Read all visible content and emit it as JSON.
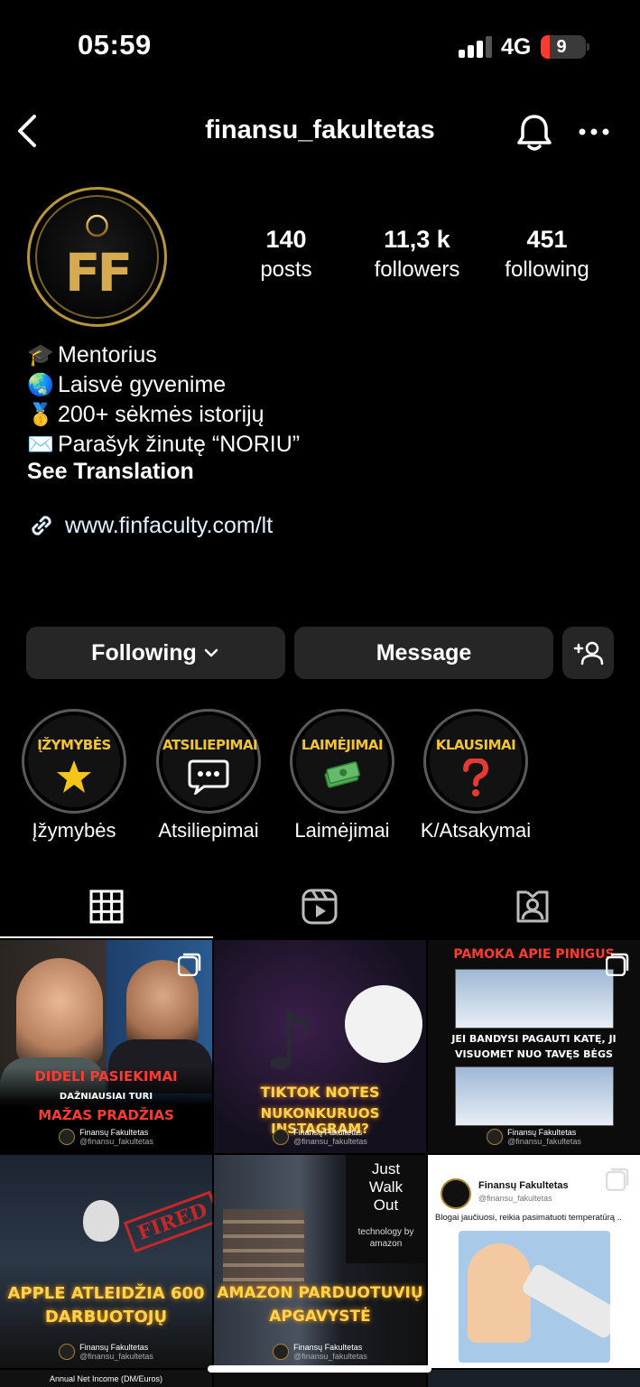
{
  "status_bar": {
    "time": "05:59",
    "network": "4G",
    "battery": "9"
  },
  "nav": {
    "username": "finansu_fakultetas",
    "back_icon": "chevron-left-icon",
    "bell_icon": "bell-icon",
    "more_icon": "more-horizontal-icon"
  },
  "profile": {
    "avatar_text": "FF",
    "stats": [
      {
        "value": "140",
        "label": "posts"
      },
      {
        "value": "11,3 k",
        "label": "followers"
      },
      {
        "value": "451",
        "label": "following"
      }
    ],
    "bio": [
      {
        "emoji": "🎓",
        "text": "Mentorius"
      },
      {
        "emoji": "🌏",
        "text": "Laisvė gyvenime"
      },
      {
        "emoji": "🥇",
        "text": "200+ sėkmės istorijų"
      },
      {
        "emoji": "✉️",
        "text": "Parašyk žinutę “NORIU”"
      }
    ],
    "see_translation": "See Translation",
    "link": "www.finfaculty.com/lt"
  },
  "buttons": {
    "following": "Following",
    "message": "Message"
  },
  "highlights": [
    {
      "title": "ĮŽYMYBĖS",
      "label": "Įžymybės",
      "icon": "star-icon"
    },
    {
      "title": "ATSILIEPIMAI",
      "label": "Atsiliepimai",
      "icon": "chat-bubble-icon"
    },
    {
      "title": "LAIMĖJIMAI",
      "label": "Laimėjimai",
      "icon": "money-icon"
    },
    {
      "title": "KLAUSIMAI",
      "label": "K/Atsakymai",
      "icon": "question-icon"
    }
  ],
  "tabs": [
    {
      "name": "grid",
      "icon": "grid-icon"
    },
    {
      "name": "reels",
      "icon": "reels-icon"
    },
    {
      "name": "tagged",
      "icon": "tagged-user-icon"
    }
  ],
  "posts": [
    {
      "lines": [
        "DIDELI PASIEKIMAI",
        "DAŽNIAUSIAI TURI",
        "MAŽAS PRADŽIAS"
      ],
      "brand": "Finansų Fakultetas",
      "handle": "@finansu_fakultetas"
    },
    {
      "lines": [
        "TIKTOK NOTES",
        "NUKONKURUOS INSTAGRAM?"
      ],
      "brand": "Finansų Fakultetas",
      "handle": "@finansu_fakultetas"
    },
    {
      "lines": [
        "PAMOKA APIE PINIGUS",
        "JEI BANDYSI PAGAUTI KATĘ, JI",
        "VISUOMET NUO TAVĘS BĖGS"
      ],
      "brand": "Finansų Fakultetas",
      "handle": "@finansu_fakultetas"
    },
    {
      "lines": [
        "APPLE ATLEIDŽIA 600",
        "DARBUOTOJŲ"
      ],
      "stamp": "FIRED",
      "brand": "Finansų Fakultetas",
      "handle": "@finansu_fakultetas"
    },
    {
      "lines": [
        "AMAZON PARDUOTUVIŲ",
        "APGAVYSTĖ"
      ],
      "sign": [
        "Just",
        "Walk",
        "Out"
      ],
      "sign_sub": [
        "technology by",
        "amazon"
      ],
      "brand": "Finansų Fakultetas",
      "handle": "@finansu_fakultetas"
    },
    {
      "tweet_name": "Finansų Fakultetas",
      "tweet_handle": "@finansu_fakultetas",
      "tweet_text": "Blogai jaučiuosi, reikia pasimatuoti temperatūrą .."
    }
  ],
  "peek_text": "Annual Net Income (DM/Euros)"
}
